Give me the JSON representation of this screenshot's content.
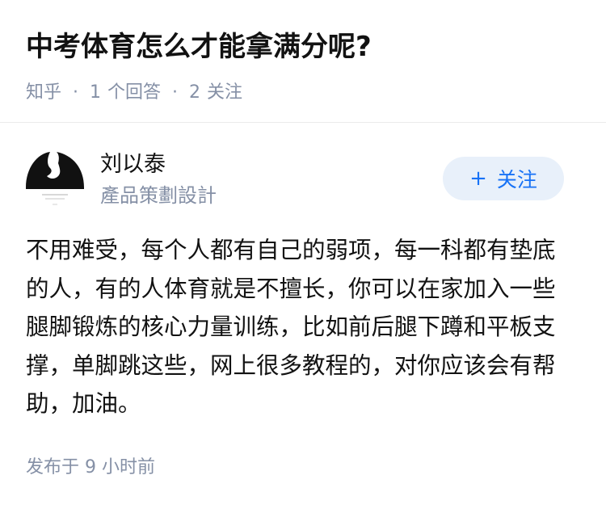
{
  "question": {
    "title": "中考体育怎么才能拿满分呢?",
    "source": "知乎",
    "answer_count": "1",
    "answer_label": "个回答",
    "follower_count": "2",
    "follower_label": "关注"
  },
  "author": {
    "name": "刘以泰",
    "bio": "產品策劃設計",
    "follow_icon": "+",
    "follow_label": "关注"
  },
  "answer": {
    "content": "不用难受，每个人都有自己的弱项，每一科都有垫底的人，有的人体育就是不擅长，你可以在家加入一些腿脚锻炼的核心力量训练，比如前后腿下蹲和平板支撑，单脚跳这些，网上很多教程的，对你应该会有帮助，加油。",
    "published": "发布于 9 小时前"
  },
  "colors": {
    "title": "#121212",
    "meta": "#8590a6",
    "accent": "#1772f6",
    "follow_bg": "#e8f0fa",
    "divider": "#ebebeb"
  }
}
